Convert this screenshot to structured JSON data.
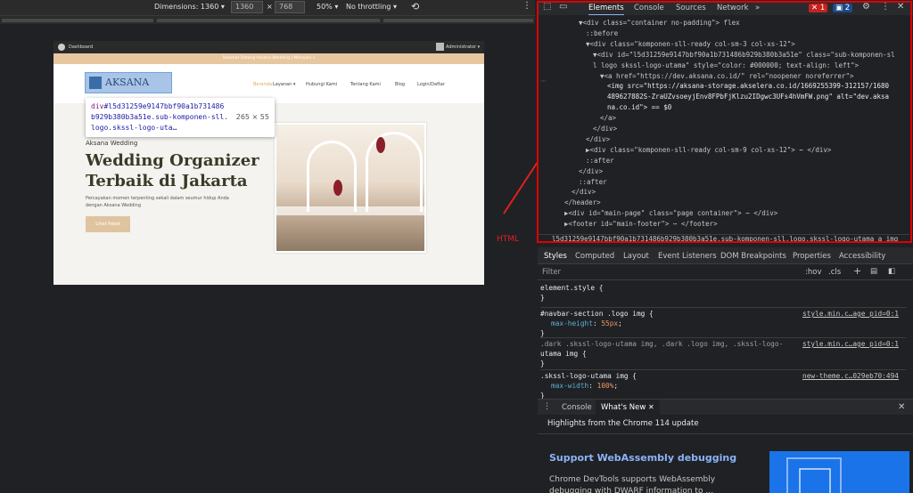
{
  "device_toolbar": {
    "dimensions_label": "Dimensions: 1360 ▾",
    "width": "1360",
    "times": "×",
    "height": "768",
    "zoom": "50% ▾",
    "throttle": "No throttling ▾"
  },
  "preview": {
    "admin_left": "Dashboard",
    "admin_right": "Administrator ▾",
    "announcement": "Selamat Datang Aksana Wedding | Melayani s",
    "logo_text": "AKSANA",
    "nav_links": [
      "Beranda",
      "Layanan ▾",
      "Hubungi Kami",
      "Tentang Kami",
      "Blog",
      "Login/Daftar"
    ],
    "hero_small": "Aksana Wedding",
    "hero_title_1": "Wedding Organizer",
    "hero_title_2": "Terbaik di Jakarta",
    "hero_desc_1": "Percayakan momen terpenting sekali dalam seumur hidup Anda",
    "hero_desc_2": "dengan Aksana Wedding",
    "cta": "Lihat Paket"
  },
  "tooltip": {
    "line1_tag": "div",
    "line1": "#l5d31259e9147bbf90a1b731486",
    "line2": "b929b380b3a51e.sub-komponen-sll.",
    "line3": "logo.skssl-logo-uta…",
    "dims": "265 × 55"
  },
  "annotation": {
    "label": "HTML",
    "color": "#e02020"
  },
  "devtools_tabs": {
    "elements": "Elements",
    "console": "Console",
    "sources": "Sources",
    "network": "Network",
    "more": "»",
    "errors": "1",
    "messages": "2"
  },
  "dom_lines": [
    {
      "indent": 0,
      "text": "▼<div class=\"container no-padding\"> flex"
    },
    {
      "indent": 1,
      "text": "::before"
    },
    {
      "indent": 1,
      "text": "▼<div class=\"komponen-sll-ready col-sm-3 col-xs-12\">"
    },
    {
      "indent": 2,
      "text": "▼<div id=\"l5d31259e9147bbf90a1b731486b929b380b3a51e\" class=\"sub-komponen-sl"
    },
    {
      "indent": 2,
      "text": "l logo skssl-logo-utama\" style=\"color: #000000; text-align: left\">"
    },
    {
      "indent": 3,
      "text": "▼<a href=\"https://dev.aksana.co.id/\" rel=\"noopener noreferrer\">"
    },
    {
      "indent": 4,
      "text": "<img src=\"https://aksana-storage.akselera.co.id/1669255399-312157/1680"
    },
    {
      "indent": 4,
      "text": "489627882S-ZraUZvsoeyjEnv8FPbFjKlzu2IDgwc3UFs4hVmFW.png\" alt=\"dev.aksa"
    },
    {
      "indent": 4,
      "text": "na.co.id\"> == $0"
    },
    {
      "indent": 3,
      "text": "</a>"
    },
    {
      "indent": 2,
      "text": "</div>"
    },
    {
      "indent": 1,
      "text": "</div>"
    },
    {
      "indent": 1,
      "text": "▶<div class=\"komponen-sll-ready col-sm-9 col-xs-12\"> ⋯ </div>"
    },
    {
      "indent": 1,
      "text": "::after"
    },
    {
      "indent": 0,
      "text": "</div>"
    },
    {
      "indent": 0,
      "text": "::after"
    },
    {
      "indent": -1,
      "text": "</div>"
    },
    {
      "indent": -2,
      "text": "</header>"
    },
    {
      "indent": -2,
      "text": "▶<div id=\"main-page\" class=\"page container\"> ⋯ </div>"
    },
    {
      "indent": -2,
      "text": "▶<footer id=\"main-footer\"> ⋯ </footer>"
    }
  ],
  "breadcrumb": "l5d31259e9147bbf90a1b731486b929b380b3a51e.sub-komponen-sll.logo.skssl-logo-utama   a   img",
  "styles_tabs": [
    "Styles",
    "Computed",
    "Layout",
    "Event Listeners",
    "DOM Breakpoints",
    "Properties",
    "Accessibility"
  ],
  "filter": {
    "placeholder": "Filter",
    "hov": ":hov",
    "cls": ".cls",
    "plus": "+"
  },
  "rules": [
    {
      "selector": "element.style {",
      "props": [],
      "source": ""
    },
    {
      "selector": "#navbar-section .logo img {",
      "props": [
        [
          "max-height",
          "55px"
        ]
      ],
      "source": "style.min.c…age_pid=0:1"
    },
    {
      "selector": ".dark .skssl-logo-utama img, .dark .logo img, .skssl-logo-",
      "selector2": "utama img {",
      "props": [],
      "source": "style.min.c…age_pid=0:1"
    },
    {
      "selector": ".skssl-logo-utama img {",
      "props": [
        [
          "max-width",
          "100%"
        ]
      ],
      "source": "new-theme.c…029eb70:494"
    }
  ],
  "drawer": {
    "console": "Console",
    "whats_new": "What's New",
    "highlights": "Highlights from the Chrome 114 update",
    "headline": "Support WebAssembly debugging",
    "body1": "Chrome DevTools supports WebAssembly",
    "body2": "debugging with DWARF information to …"
  }
}
